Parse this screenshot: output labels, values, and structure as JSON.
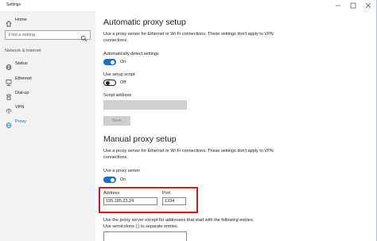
{
  "window": {
    "title": "Settings"
  },
  "sidebar": {
    "home": "Home",
    "search_placeholder": "Find a setting",
    "section": "Network & Internet",
    "items": [
      {
        "label": "Status",
        "icon": "globe-icon"
      },
      {
        "label": "Ethernet",
        "icon": "ethernet-icon"
      },
      {
        "label": "Dial-up",
        "icon": "dialup-icon"
      },
      {
        "label": "VPN",
        "icon": "vpn-icon"
      },
      {
        "label": "Proxy",
        "icon": "globe-icon",
        "active": true
      }
    ]
  },
  "auto": {
    "heading": "Automatic proxy setup",
    "desc": "Use a proxy server for Ethernet or Wi-Fi connections. These settings don't apply to VPN connections.",
    "detect_label": "Automatically detect settings",
    "detect_state": "On",
    "script_label": "Use setup script",
    "script_state": "Off",
    "address_label": "Script address",
    "save": "Save"
  },
  "manual": {
    "heading": "Manual proxy setup",
    "desc": "Use a proxy server for Ethernet or Wi-Fi connections. These settings don't apply to VPN connections.",
    "use_label": "Use a proxy server",
    "use_state": "On",
    "address_label": "Address",
    "address_value": "195.185.23.24",
    "port_label": "Port",
    "port_value": "1334",
    "except_desc": "Use the proxy server except for addresses that start with the following entries. Use semicolons (;) to separate entries."
  },
  "colors": {
    "accent": "#1a6ebd",
    "highlight": "#d0141b"
  }
}
